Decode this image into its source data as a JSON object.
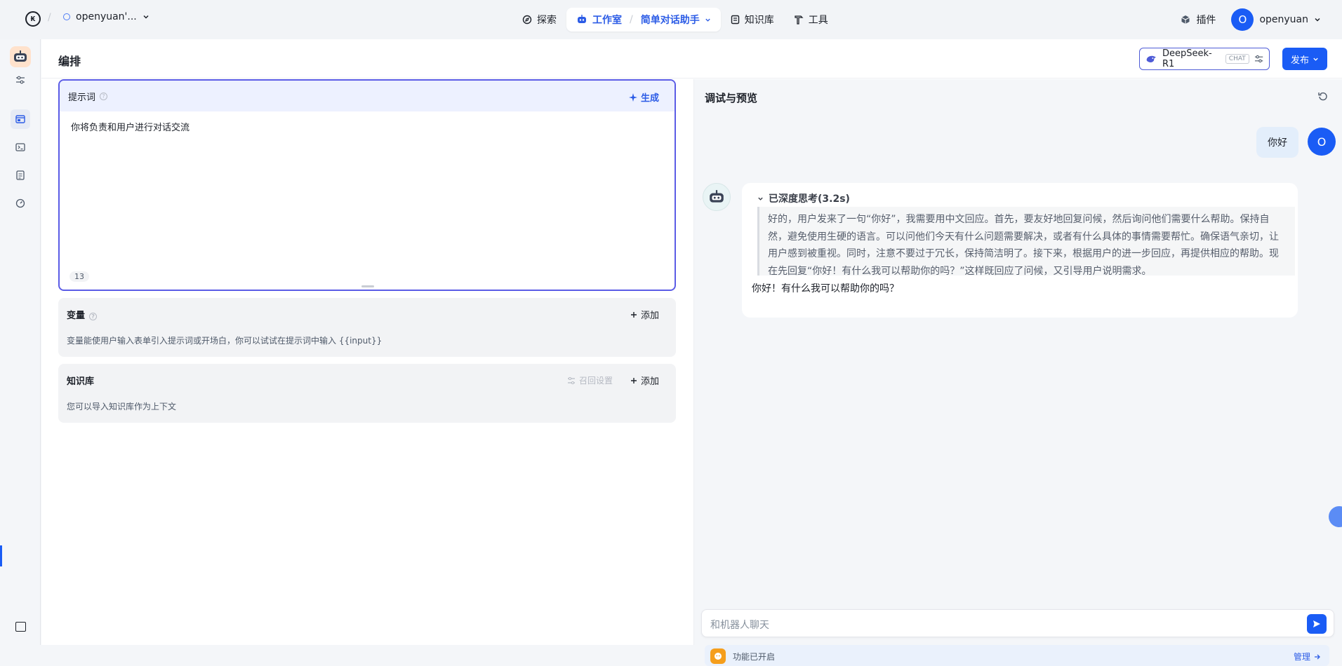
{
  "topbar": {
    "workspace_name": "openyuan'...",
    "nav": [
      {
        "label": "探索"
      },
      {
        "label": "工作室",
        "sub": "简单对话助手"
      },
      {
        "label": "知识库"
      },
      {
        "label": "工具"
      }
    ],
    "plugin_label": "插件",
    "user_initial": "O",
    "user_name": "openyuan"
  },
  "header": {
    "title": "编排",
    "model_name": "DeepSeek-R1",
    "model_tag": "CHAT",
    "publish_label": "发布"
  },
  "prompt": {
    "title": "提示词",
    "generate_label": "生成",
    "text": "你将负责和用户进行对话交流",
    "count": "13"
  },
  "variables": {
    "title": "变量",
    "add_label": "添加",
    "desc": "变量能使用户输入表单引入提示词或开场白，你可以试试在提示词中输入 {{input}}"
  },
  "knowledge": {
    "title": "知识库",
    "recall_label": "召回设置",
    "add_label": "添加",
    "desc": "您可以导入知识库作为上下文"
  },
  "debug": {
    "title": "调试与预览",
    "user_message": "你好",
    "user_initial": "O",
    "thinking_label": "已深度思考(3.2s)",
    "thinking_text": "好的，用户发来了一句“你好”，我需要用中文回应。首先，要友好地回复问候，然后询问他们需要什么帮助。保持自然，避免使用生硬的语言。可以问他们今天有什么问题需要解决，或者有什么具体的事情需要帮忙。确保语气亲切，让用户感到被重视。同时，注意不要过于冗长，保持简洁明了。接下来，根据用户的进一步回应，再提供相应的帮助。现在先回复“你好！有什么我可以帮助你的吗？”这样既回应了问候，又引导用户说明需求。",
    "answer": "你好！有什么我可以帮助你的吗？",
    "input_placeholder": "和机器人聊天",
    "feature_label": "功能已开启",
    "manage_label": "管理"
  },
  "colors": {
    "accent": "#1a5cf5",
    "prompt_border": "#5b5ce6",
    "feature_icon": "#f59e1c"
  }
}
